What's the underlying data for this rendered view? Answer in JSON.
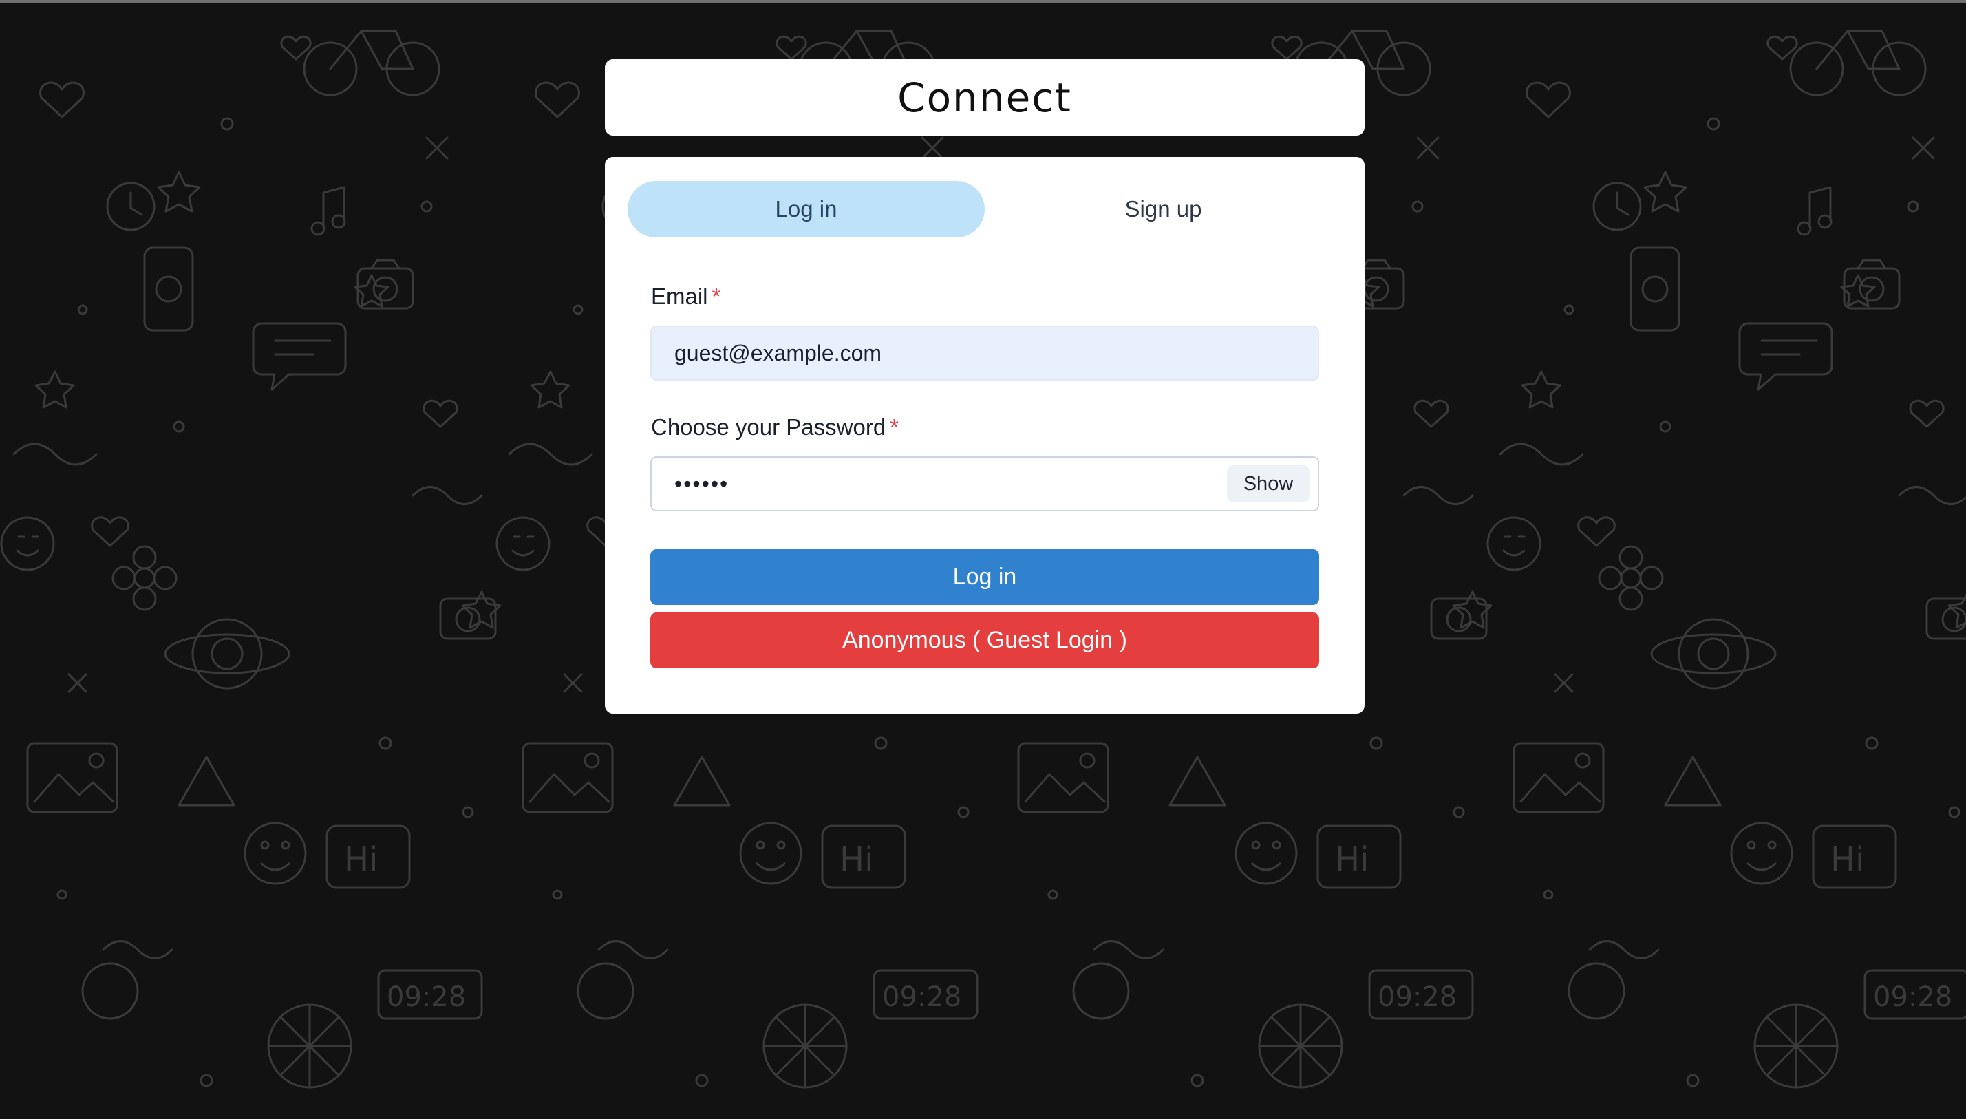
{
  "page": {
    "title": "Connect"
  },
  "tabs": [
    {
      "label": "Log in",
      "active": true
    },
    {
      "label": "Sign up",
      "active": false
    }
  ],
  "form": {
    "email": {
      "label": "Email",
      "required_marker": "*",
      "value": "guest@example.com"
    },
    "password": {
      "label": "Choose your Password",
      "required_marker": "*",
      "masked_value": "••••••",
      "toggle_label": "Show"
    },
    "login_button_label": "Log in",
    "guest_button_label": "Anonymous ( Guest Login )"
  },
  "background": {
    "doodle_texts": [
      "Hi",
      "09:28"
    ]
  },
  "colors": {
    "background": "#121212",
    "doodle_stroke": "#3a3a3a",
    "active_tab": "#bee3f8",
    "email_fill": "#e8f0fe",
    "login_button": "#3182ce",
    "guest_button": "#e53e3e",
    "required_marker": "#e53e3e"
  },
  "icons": [
    "heart-icon",
    "star-icon",
    "camera-icon",
    "bicycle-icon",
    "smiley-icon",
    "chat-bubble-icon",
    "clock-icon",
    "image-icon",
    "music-note-icon",
    "phone-icon",
    "flower-icon",
    "planet-icon"
  ]
}
